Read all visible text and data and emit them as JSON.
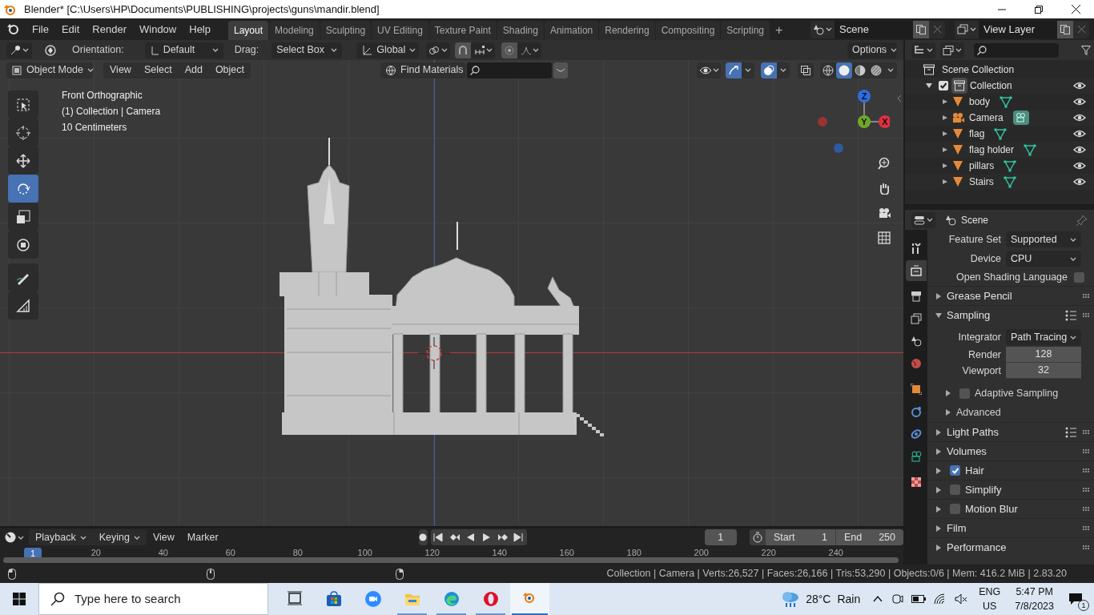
{
  "window": {
    "title": "Blender* [C:\\Users\\HP\\Documents\\PUBLISHING\\projects\\guns\\mandir.blend]"
  },
  "menu": [
    "File",
    "Edit",
    "Render",
    "Window",
    "Help"
  ],
  "workspaces": [
    {
      "label": "Layout",
      "selected": true
    },
    {
      "label": "Modeling",
      "selected": false
    },
    {
      "label": "Sculpting",
      "selected": false
    },
    {
      "label": "UV Editing",
      "selected": false
    },
    {
      "label": "Texture Paint",
      "selected": false
    },
    {
      "label": "Shading",
      "selected": false
    },
    {
      "label": "Animation",
      "selected": false
    },
    {
      "label": "Rendering",
      "selected": false
    },
    {
      "label": "Compositing",
      "selected": false
    },
    {
      "label": "Scripting",
      "selected": false
    }
  ],
  "add_workspace": "+",
  "scene": "Scene",
  "view_layer": "View Layer",
  "tool_header": {
    "orientation_label": "Orientation:",
    "orientation": "Default",
    "drag_label": "Drag:",
    "drag": "Select Box",
    "transform": "Global",
    "options": "Options"
  },
  "viewport_header": {
    "mode": "Object Mode",
    "menus": [
      "View",
      "Select",
      "Add",
      "Object"
    ],
    "search_mode": "Find Materials",
    "gizmos_on": true,
    "overlays_on": true,
    "shading": [
      {
        "kind": "wireframe",
        "selected": false
      },
      {
        "kind": "solid",
        "selected": true
      },
      {
        "kind": "material",
        "selected": false
      },
      {
        "kind": "rendered",
        "selected": false
      }
    ]
  },
  "viewport_info": [
    "Front Orthographic",
    "(1) Collection | Camera",
    "10 Centimeters"
  ],
  "tools": [
    {
      "kind": "select",
      "selected": false
    },
    {
      "kind": "cursor",
      "selected": false
    },
    {
      "kind": "move",
      "selected": false
    },
    {
      "kind": "rotate",
      "selected": true
    },
    {
      "kind": "scale",
      "selected": false
    },
    {
      "kind": "transform",
      "selected": false
    },
    {
      "kind": "annotate",
      "selected": false
    },
    {
      "kind": "measure",
      "selected": false
    }
  ],
  "gizmo_axes": {
    "z": "Z",
    "y": "Y",
    "x": "X"
  },
  "outliner": {
    "root": "Scene Collection",
    "collection": {
      "label": "Collection",
      "checked": true,
      "expanded": true,
      "children": [
        {
          "label": "body",
          "kind": "mesh"
        },
        {
          "label": "Camera",
          "kind": "camera"
        },
        {
          "label": "flag",
          "kind": "mesh"
        },
        {
          "label": "flag holder",
          "kind": "mesh"
        },
        {
          "label": "pillars",
          "kind": "mesh"
        },
        {
          "label": "Stairs",
          "kind": "mesh"
        }
      ]
    }
  },
  "properties": {
    "context": "Scene",
    "tabs": [
      {
        "kind": "tool",
        "selected": false
      },
      {
        "kind": "render",
        "selected": true
      },
      {
        "kind": "output",
        "selected": false
      },
      {
        "kind": "view_layer",
        "selected": false
      },
      {
        "kind": "scene",
        "selected": false
      },
      {
        "kind": "world",
        "selected": false
      },
      {
        "kind": "object",
        "selected": false
      },
      {
        "kind": "physics",
        "selected": false
      },
      {
        "kind": "constraints",
        "selected": false
      },
      {
        "kind": "data",
        "selected": false
      },
      {
        "kind": "texture",
        "selected": false
      }
    ],
    "rows": [
      {
        "kind": "dropdown",
        "label": "Feature Set",
        "value": "Supported"
      },
      {
        "kind": "dropdown",
        "label": "Device",
        "value": "CPU"
      },
      {
        "kind": "toggle",
        "label": "Open Shading Language",
        "checked": false
      },
      {
        "kind": "panel",
        "label": "Grease Pencil",
        "expanded": false
      },
      {
        "kind": "panel",
        "label": "Sampling",
        "expanded": true,
        "presets": true
      },
      {
        "kind": "dropdown",
        "label": "Integrator",
        "value": "Path Tracing"
      },
      {
        "kind": "number",
        "label": "Render",
        "value": "128"
      },
      {
        "kind": "number",
        "label": "Viewport",
        "value": "32"
      },
      {
        "kind": "subpanel",
        "label": "Adaptive Sampling",
        "expanded": false,
        "checked": false
      },
      {
        "kind": "subpanel",
        "label": "Advanced",
        "expanded": false
      },
      {
        "kind": "panel",
        "label": "Light Paths",
        "expanded": false,
        "presets": true
      },
      {
        "kind": "panel",
        "label": "Volumes",
        "expanded": false
      },
      {
        "kind": "panel",
        "label": "Hair",
        "expanded": false,
        "checked": true
      },
      {
        "kind": "panel",
        "label": "Simplify",
        "expanded": false,
        "checked": false
      },
      {
        "kind": "panel",
        "label": "Motion Blur",
        "expanded": false,
        "checked": false
      },
      {
        "kind": "panel",
        "label": "Film",
        "expanded": false
      },
      {
        "kind": "panel",
        "label": "Performance",
        "expanded": false
      }
    ]
  },
  "timeline": {
    "menus": [
      "Playback",
      "Keying",
      "View",
      "Marker"
    ],
    "current_frame": "1",
    "start_label": "Start",
    "start": "1",
    "end_label": "End",
    "end": "250",
    "playhead": "1",
    "ruler": [
      "20",
      "40",
      "60",
      "80",
      "100",
      "120",
      "140",
      "160",
      "180",
      "200",
      "220",
      "240"
    ]
  },
  "status_bar": "Collection | Camera | Verts:26,527 | Faces:26,166 | Tris:53,290 | Objects:0/6 | Mem: 416.2 MiB | 2.83.20",
  "taskbar": {
    "search_placeholder": "Type here to search",
    "apps": [
      {
        "kind": "task_view",
        "running": false,
        "selected": false
      },
      {
        "kind": "store",
        "running": false,
        "selected": false
      },
      {
        "kind": "zoom",
        "running": false,
        "selected": false
      },
      {
        "kind": "files",
        "running": true,
        "selected": false
      },
      {
        "kind": "edge",
        "running": true,
        "selected": false
      },
      {
        "kind": "opera",
        "running": true,
        "selected": false
      },
      {
        "kind": "blender",
        "running": true,
        "selected": true
      }
    ],
    "temperature": "28°C",
    "weather": "Rain",
    "language": "ENG",
    "region": "US",
    "time": "5:47 PM",
    "date": "7/8/2023",
    "notifications": "1"
  }
}
